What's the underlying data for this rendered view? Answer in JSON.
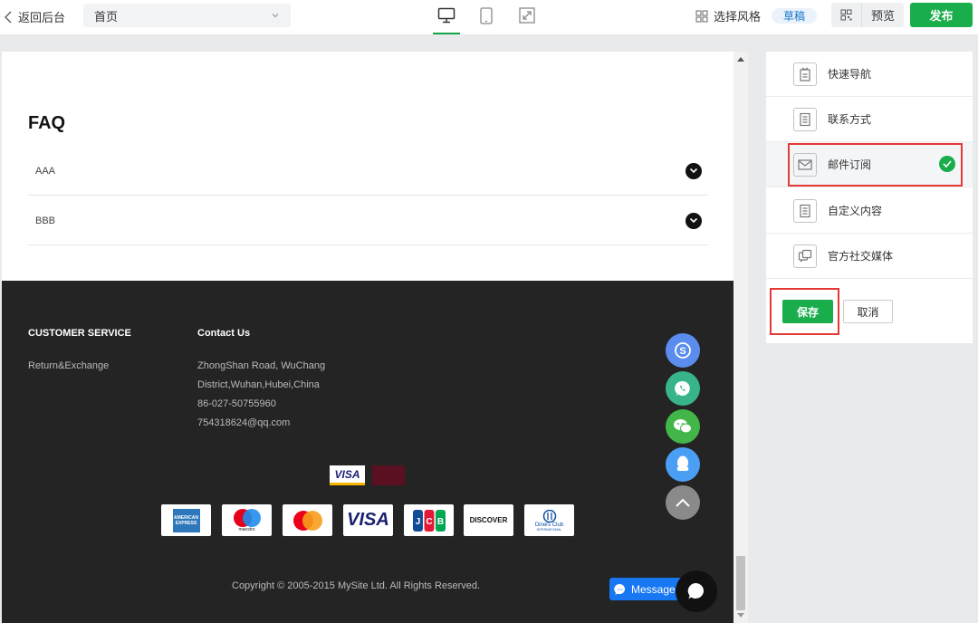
{
  "topbar": {
    "back_label": "返回后台",
    "page_select_value": "首页",
    "style_label": "选择风格",
    "draft_badge": "草稿",
    "preview_label": "预览",
    "publish_label": "发布"
  },
  "faq": {
    "title": "FAQ",
    "items": [
      {
        "label": "AAA"
      },
      {
        "label": "BBB"
      }
    ]
  },
  "footer": {
    "customer_service": {
      "heading": "CUSTOMER SERVICE",
      "links": [
        "Return&Exchange"
      ]
    },
    "contact": {
      "heading": "Contact Us",
      "lines": [
        "ZhongShan Road, WuChang",
        "District,Wuhan,Hubei,China",
        "86-027-50755960",
        "754318624@qq.com"
      ]
    },
    "payment_small": {
      "visa": "VISA"
    },
    "payment_cards": {
      "amex": "AMERICAN EXPRESS",
      "maestro": "maestro",
      "visa": "VISA",
      "discover": "DISCOVER",
      "diners": "Diners Club",
      "diners_sub": "INTERNATIONAL"
    },
    "copyright": "Copyright © 2005-2015 MySite Ltd. All Rights Reserved."
  },
  "messenger_label": "Message",
  "panel": {
    "items": [
      {
        "label": "快速导航",
        "icon": "nav-doc-icon"
      },
      {
        "label": "联系方式",
        "icon": "contact-doc-icon"
      },
      {
        "label": "邮件订阅",
        "icon": "mail-icon"
      },
      {
        "label": "自定义内容",
        "icon": "custom-doc-icon"
      },
      {
        "label": "官方社交媒体",
        "icon": "social-share-icon"
      }
    ],
    "save_label": "保存",
    "cancel_label": "取消"
  },
  "colors": {
    "accent": "#1aad4b",
    "highlight": "#e53935",
    "footer_bg": "#242424",
    "draft_text": "#1677c9"
  }
}
